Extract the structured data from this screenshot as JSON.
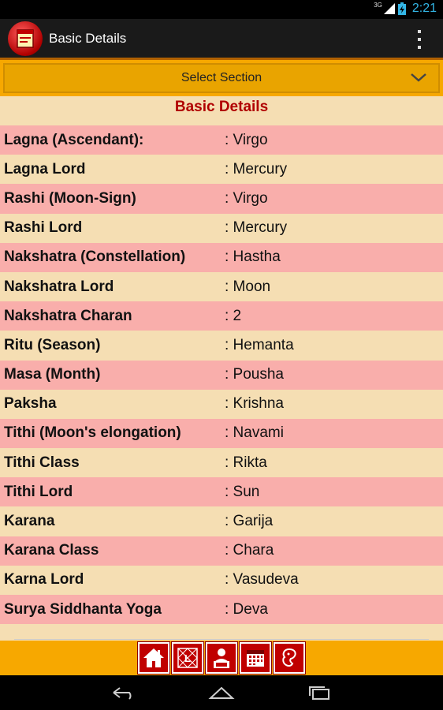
{
  "status_bar": {
    "network": "3G",
    "time": "2:21"
  },
  "action_bar": {
    "title": "Basic Details"
  },
  "select_section": {
    "label": "Select Section"
  },
  "section_title": "Basic Details",
  "rows": [
    {
      "label": "Lagna (Ascendant):",
      "value": ": Virgo"
    },
    {
      "label": "Lagna Lord",
      "value": ": Mercury"
    },
    {
      "label": "Rashi (Moon-Sign)",
      "value": ": Virgo"
    },
    {
      "label": "Rashi Lord",
      "value": ": Mercury"
    },
    {
      "label": "Nakshatra (Constellation)",
      "value": ": Hastha"
    },
    {
      "label": "Nakshatra Lord",
      "value": ": Moon"
    },
    {
      "label": "Nakshatra Charan",
      "value": ": 2"
    },
    {
      "label": "Ritu (Season)",
      "value": ": Hemanta"
    },
    {
      "label": "Masa (Month)",
      "value": ": Pousha"
    },
    {
      "label": "Paksha",
      "value": ": Krishna"
    },
    {
      "label": "Tithi (Moon's elongation)",
      "value": ": Navami"
    },
    {
      "label": "Tithi Class",
      "value": ": Rikta"
    },
    {
      "label": "Tithi Lord",
      "value": ": Sun"
    },
    {
      "label": "Karana",
      "value": ": Garija"
    },
    {
      "label": "Karana Class",
      "value": ": Chara"
    },
    {
      "label": "Karna Lord",
      "value": ": Vasudeva"
    },
    {
      "label": "Surya Siddhanta Yoga",
      "value": ": Deva"
    }
  ],
  "bottom_nav": [
    "home-icon",
    "kundli-chart-icon",
    "astrologer-icon",
    "calendar-icon",
    "ganesha-icon"
  ],
  "system_nav": [
    "back-icon",
    "home-icon",
    "recent-apps-icon"
  ],
  "colors": {
    "accent": "#f7a800",
    "title_red": "#b00000",
    "row_pink": "#f9aeab",
    "row_cream": "#f5deb3"
  }
}
